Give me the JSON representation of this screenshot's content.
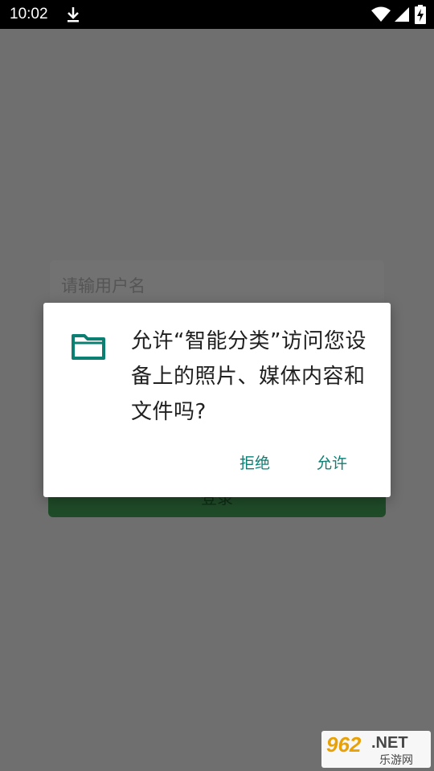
{
  "status_bar": {
    "time": "10:02",
    "icons": [
      "download-icon",
      "wifi-icon",
      "signal-icon",
      "battery-charging-icon"
    ]
  },
  "app": {
    "username_placeholder": "请输用户名",
    "login_label": "登录",
    "colors": {
      "login_button": "#1f4b28"
    }
  },
  "dialog": {
    "icon": "folder-icon",
    "message": "允许“智能分类”访问您设备上的照片、媒体内容和文件吗?",
    "deny_label": "拒绝",
    "allow_label": "允许",
    "colors": {
      "accent": "#0c7f73"
    }
  },
  "watermark": {
    "number": "962",
    "suffix": ".NET",
    "site_name": "乐游网"
  }
}
